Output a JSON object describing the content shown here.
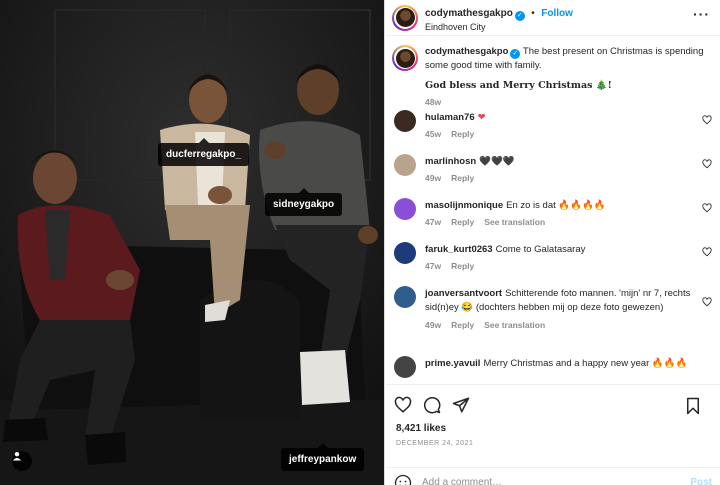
{
  "photo": {
    "tags": [
      "ducferregakpo_",
      "sidneygakpo",
      "jeffreypankow"
    ]
  },
  "header": {
    "username": "codymathesgakpo",
    "separator": "•",
    "follow_label": "Follow",
    "location": "Eindhoven City",
    "more_icon": "more-horizontal-icon"
  },
  "caption": {
    "username": "codymathesgakpo",
    "text": "The best present on Christmas is spending some good time with family.",
    "line2": "God bless and Merry Christmas 🎄!",
    "time": "48w"
  },
  "comments": [
    {
      "user": "hulaman76",
      "text": "❤",
      "time": "45w",
      "reply": "Reply",
      "translate": "",
      "avatar_color": "#3a2a22"
    },
    {
      "user": "marlinhosn",
      "text": "🖤🖤🖤",
      "time": "49w",
      "reply": "Reply",
      "translate": "",
      "avatar_color": "#b8a48c"
    },
    {
      "user": "masolijnmonique",
      "text": "En zo is dat 🔥🔥🔥🔥",
      "time": "47w",
      "reply": "Reply",
      "translate": "See translation",
      "avatar_color": "#8a4fd6"
    },
    {
      "user": "faruk_kurt0263",
      "text": "Come to Galatasaray",
      "time": "47w",
      "reply": "Reply",
      "translate": "",
      "avatar_color": "#1d3b7a"
    },
    {
      "user": "joanversantvoort",
      "text": "Schitterende foto mannen. 'mijn' nr 7, rechts sid(n)ey 😂 (dochters hebben mij op deze foto gewezen)",
      "time": "49w",
      "reply": "Reply",
      "translate": "See translation",
      "avatar_color": "#2f5d8c"
    },
    {
      "user": "prime.yavuil",
      "text": "Merry Christmas and a happy new year 🔥🔥🔥",
      "time": "",
      "reply": "",
      "translate": "",
      "avatar_color": "#444444"
    }
  ],
  "actions": {
    "likes": "8,421 likes",
    "date": "DECEMBER 24, 2021",
    "add_comment_placeholder": "Add a comment…",
    "post_label": "Post"
  },
  "colors": {
    "link_blue": "#0095f6",
    "muted": "#8e8e8e",
    "heart_red": "#ed4956"
  }
}
